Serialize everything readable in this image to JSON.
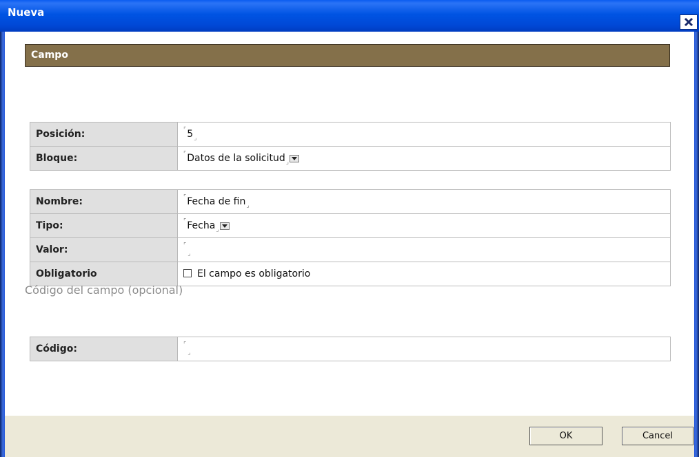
{
  "window": {
    "title": "Nueva"
  },
  "section": {
    "title": "Campo"
  },
  "fields_group1": [
    {
      "label": "Posición:",
      "value": "5",
      "type": "text"
    },
    {
      "label": "Bloque:",
      "value": "Datos de la solicitud",
      "type": "select"
    }
  ],
  "fields_group2": [
    {
      "label": "Nombre:",
      "value": "Fecha de fin",
      "type": "text"
    },
    {
      "label": "Tipo:",
      "value": "Fecha",
      "type": "select"
    },
    {
      "label": "Valor:",
      "value": "",
      "type": "text"
    },
    {
      "label": "Obligatorio",
      "value": "El campo es obligatorio",
      "type": "checkbox",
      "checked": false
    }
  ],
  "optional": {
    "title": "Código del campo (opcional)",
    "label": "Código:",
    "value": ""
  },
  "buttons": {
    "ok": "OK",
    "cancel": "Cancel"
  },
  "colors": {
    "section_header": "#84704a",
    "titlebar": "#0054e3",
    "footer": "#ece9d8"
  }
}
